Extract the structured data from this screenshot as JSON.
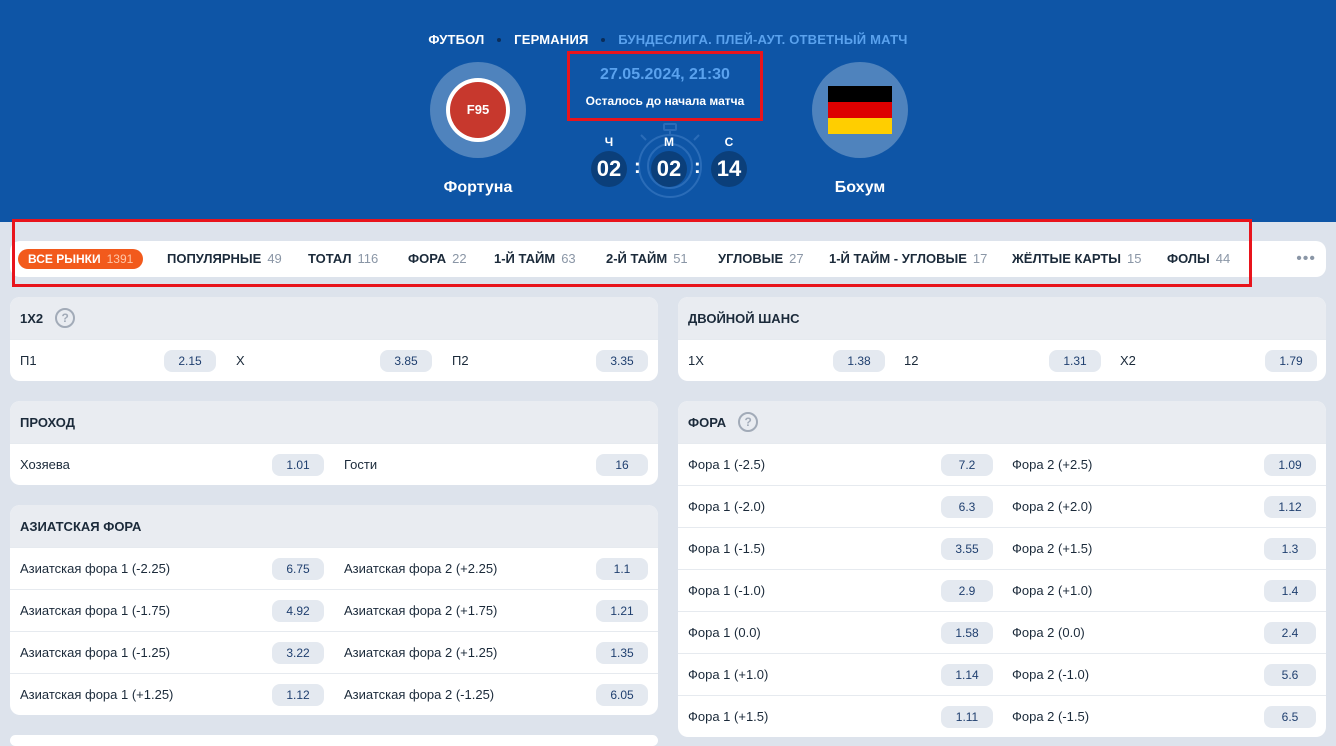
{
  "breadcrumbs": [
    "ФУТБОЛ",
    "ГЕРМАНИЯ",
    "БУНДЕСЛИГА. ПЛЕЙ-АУТ. ОТВЕТНЫЙ МАТЧ"
  ],
  "match": {
    "home": {
      "name": "Фортуна",
      "logo_text": "F95"
    },
    "away": {
      "name": "Бохум",
      "flag_colors": [
        "#000000",
        "#dd0000",
        "#ffce00"
      ]
    },
    "datetime": "27.05.2024, 21:30",
    "until_label": "Осталось до начала матча",
    "timer": {
      "h_label": "Ч",
      "m_label": "М",
      "s_label": "С",
      "h": "02",
      "m": "02",
      "s": "14",
      "sep": ":"
    }
  },
  "tabs": [
    {
      "label": "ВСЕ РЫНКИ",
      "count": "1391",
      "active": true
    },
    {
      "label": "ПОПУЛЯРНЫЕ",
      "count": "49"
    },
    {
      "label": "ТОТАЛ",
      "count": "116"
    },
    {
      "label": "ФОРА",
      "count": "22"
    },
    {
      "label": "1-Й ТАЙМ",
      "count": "63"
    },
    {
      "label": "2-Й ТАЙМ",
      "count": "51"
    },
    {
      "label": "УГЛОВЫЕ",
      "count": "27"
    },
    {
      "label": "1-Й ТАЙМ - УГЛОВЫЕ",
      "count": "17"
    },
    {
      "label": "ЖЁЛТЫЕ КАРТЫ",
      "count": "15"
    },
    {
      "label": "ФОЛЫ",
      "count": "44"
    }
  ],
  "more_label": "•••",
  "markets": {
    "m1x2": {
      "title": "1X2",
      "help": "?",
      "rows": [
        [
          {
            "label": "П1",
            "odd": "2.15"
          },
          {
            "label": "Х",
            "odd": "3.85"
          },
          {
            "label": "П2",
            "odd": "3.35"
          }
        ]
      ]
    },
    "double": {
      "title": "ДВОЙНОЙ ШАНС",
      "rows": [
        [
          {
            "label": "1X",
            "odd": "1.38"
          },
          {
            "label": "12",
            "odd": "1.31"
          },
          {
            "label": "X2",
            "odd": "1.79"
          }
        ]
      ]
    },
    "pass": {
      "title": "ПРОХОД",
      "rows": [
        [
          {
            "label": "Хозяева",
            "odd": "1.01"
          },
          {
            "label": "Гости",
            "odd": "16"
          }
        ]
      ]
    },
    "asian": {
      "title": "АЗИАТСКАЯ ФОРА",
      "rows": [
        [
          {
            "label": "Азиатская фора 1 (-2.25)",
            "odd": "6.75"
          },
          {
            "label": "Азиатская фора 2 (+2.25)",
            "odd": "1.1"
          }
        ],
        [
          {
            "label": "Азиатская фора 1 (-1.75)",
            "odd": "4.92"
          },
          {
            "label": "Азиатская фора 2 (+1.75)",
            "odd": "1.21"
          }
        ],
        [
          {
            "label": "Азиатская фора 1 (-1.25)",
            "odd": "3.22"
          },
          {
            "label": "Азиатская фора 2 (+1.25)",
            "odd": "1.35"
          }
        ],
        [
          {
            "label": "Азиатская фора 1 (+1.25)",
            "odd": "1.12"
          },
          {
            "label": "Азиатская фора 2 (-1.25)",
            "odd": "6.05"
          }
        ]
      ]
    },
    "handicap": {
      "title": "ФОРА",
      "help": "?",
      "rows": [
        [
          {
            "label": "Фора 1 (-2.5)",
            "odd": "7.2"
          },
          {
            "label": "Фора 2 (+2.5)",
            "odd": "1.09"
          }
        ],
        [
          {
            "label": "Фора 1 (-2.0)",
            "odd": "6.3"
          },
          {
            "label": "Фора 2 (+2.0)",
            "odd": "1.12"
          }
        ],
        [
          {
            "label": "Фора 1 (-1.5)",
            "odd": "3.55"
          },
          {
            "label": "Фора 2 (+1.5)",
            "odd": "1.3"
          }
        ],
        [
          {
            "label": "Фора 1 (-1.0)",
            "odd": "2.9"
          },
          {
            "label": "Фора 2 (+1.0)",
            "odd": "1.4"
          }
        ],
        [
          {
            "label": "Фора 1 (0.0)",
            "odd": "1.58"
          },
          {
            "label": "Фора 2 (0.0)",
            "odd": "2.4"
          }
        ],
        [
          {
            "label": "Фора 1 (+1.0)",
            "odd": "1.14"
          },
          {
            "label": "Фора 2 (-1.0)",
            "odd": "5.6"
          }
        ],
        [
          {
            "label": "Фора 1 (+1.5)",
            "odd": "1.11"
          },
          {
            "label": "Фора 2 (-1.5)",
            "odd": "6.5"
          }
        ]
      ]
    }
  }
}
